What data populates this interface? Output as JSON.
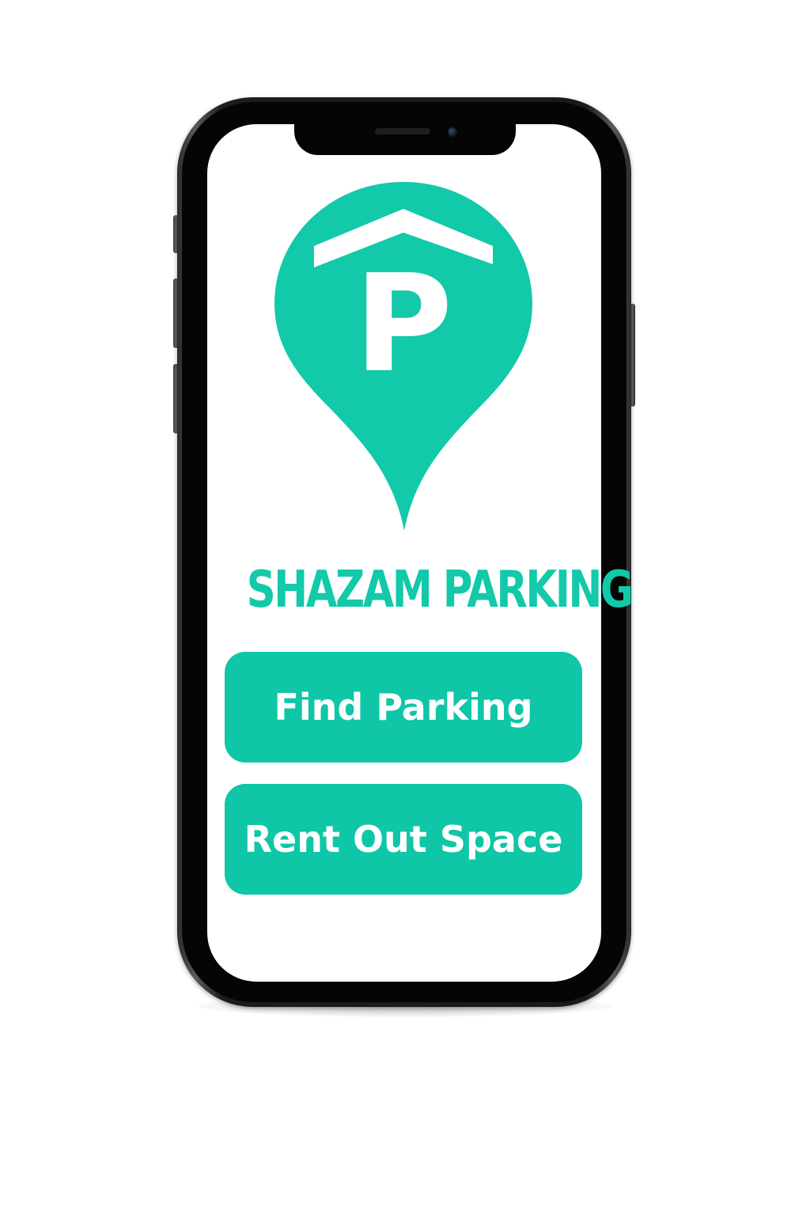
{
  "app": {
    "brand_name": "SHAZAM PARKING",
    "logo_letter": "P",
    "accent_color": "#12c9a9",
    "logo_icon": "parking-location-pin-icon"
  },
  "actions": {
    "find_parking_label": "Find Parking",
    "rent_out_space_label": "Rent Out Space",
    "button_color": "#0fc6a7",
    "button_text_color": "#ffffff"
  },
  "device": {
    "frame": "smartphone-with-notch"
  }
}
